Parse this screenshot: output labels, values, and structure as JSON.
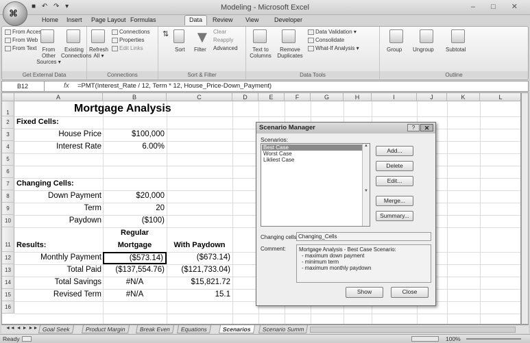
{
  "window": {
    "title": "Modeling - Microsoft Excel",
    "qat": "■ ↶ ↷ ▾",
    "controls": "– □ ✕",
    "office_glyph": "⌘"
  },
  "tabs": [
    "Home",
    "Insert",
    "Page Layout",
    "Formulas",
    "Data",
    "Review",
    "View",
    "Developer"
  ],
  "active_tab": "Data",
  "ribbon": {
    "get_external": {
      "items": [
        "From Access",
        "From Web",
        "From Text"
      ],
      "other_sources": "From Other Sources ▾",
      "existing": "Existing Connections",
      "label": "Get External Data"
    },
    "connections": {
      "refresh": "Refresh All ▾",
      "items": [
        "Connections",
        "Properties",
        "Edit Links"
      ],
      "label": "Connections"
    },
    "sort_filter": {
      "sort": "Sort",
      "filter": "Filter",
      "items": [
        "Clear",
        "Reapply",
        "Advanced"
      ],
      "label": "Sort & Filter"
    },
    "data_tools": {
      "text_to_columns": "Text to Columns",
      "remove_duplicates": "Remove Duplicates",
      "items": [
        "Data Validation ▾",
        "Consolidate",
        "What-If Analysis ▾"
      ],
      "label": "Data Tools"
    },
    "outline": {
      "items": [
        "Group",
        "Ungroup",
        "Subtotal"
      ],
      "label": "Outline"
    }
  },
  "formula_bar": {
    "name_box": "B12",
    "fx": "fx",
    "formula": "=PMT(Interest_Rate / 12, Term * 12, House_Price-Down_Payment)"
  },
  "columns": [
    "A",
    "B",
    "C",
    "D",
    "E",
    "F",
    "G",
    "H",
    "I",
    "J",
    "K",
    "L"
  ],
  "rows": [
    "1",
    "2",
    "3",
    "4",
    "5",
    "6",
    "7",
    "8",
    "9",
    "10",
    "11",
    "12",
    "13",
    "14",
    "15",
    "16"
  ],
  "cells": {
    "title": "Mortgage Analysis",
    "fixed_cells": "Fixed Cells:",
    "house_price_label": "House Price",
    "house_price": "$100,000",
    "interest_rate_label": "Interest Rate",
    "interest_rate": "6.00%",
    "changing_cells": "Changing Cells:",
    "down_payment_label": "Down Payment",
    "down_payment": "$20,000",
    "term_label": "Term",
    "term": "20",
    "paydown_label": "Paydown",
    "paydown": "($100)",
    "regular_hdr1": "Regular",
    "regular_hdr2": "Mortgage",
    "with_paydown_hdr": "With Paydown",
    "results": "Results:",
    "monthly_payment_label": "Monthly Payment",
    "monthly_regular": "($573.14)",
    "monthly_paydown": "($673.14)",
    "total_paid_label": "Total Paid",
    "total_regular": "($137,554.76)",
    "total_paydown": "($121,733.04)",
    "total_savings_label": "Total Savings",
    "savings_regular": "#N/A",
    "savings_paydown": "$15,821.72",
    "revised_term_label": "Revised Term",
    "revised_regular": "#N/A",
    "revised_paydown": "15.1"
  },
  "sheet_tabs": [
    "Goal Seek",
    "Product Margin",
    "Break Even",
    "Equations",
    "Scenarios",
    "Scenario Summ"
  ],
  "active_sheet": "Scenarios",
  "sheet_nav": "◄◄ ◄ ► ►►",
  "status": {
    "ready": "Ready",
    "zoom": "100%"
  },
  "dialog": {
    "title": "Scenario Manager",
    "help": "?",
    "close": "✕",
    "scenarios_label": "Scenarios:",
    "scenarios": [
      "Best Case",
      "Worst Case",
      "Likliest Case"
    ],
    "selected": "Best Case",
    "buttons": {
      "add": "Add...",
      "delete": "Delete",
      "edit": "Edit...",
      "merge": "Merge...",
      "summary": "Summary...",
      "show": "Show",
      "close": "Close"
    },
    "changing_cells_label": "Changing cells:",
    "changing_cells": "Changing_Cells",
    "comment_label": "Comment:",
    "comment_lines": [
      "Mortgage Analysis - Best Case Scenario:",
      "- maximum down payment",
      "- minimum term",
      "- maximum monthly paydown"
    ]
  }
}
